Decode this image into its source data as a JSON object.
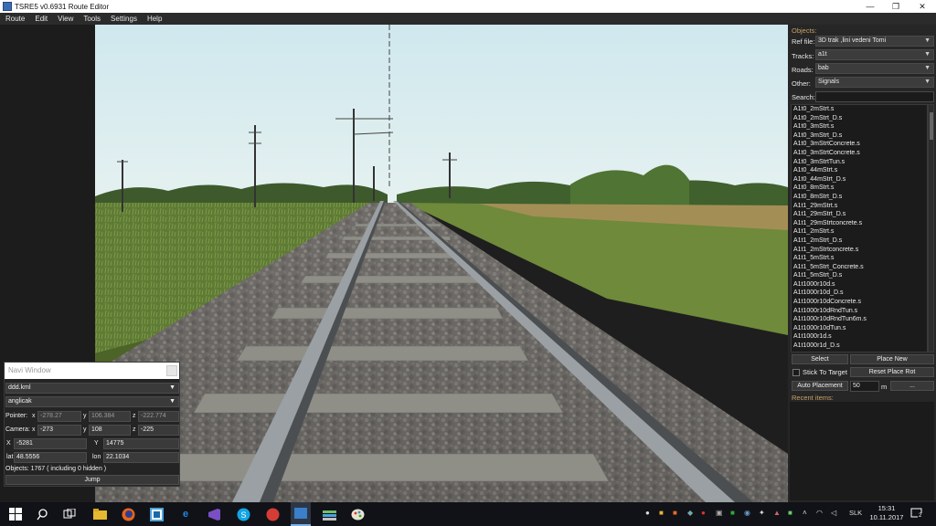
{
  "window": {
    "title": "TSRE5 v0.6931 Route Editor",
    "controls": [
      "—",
      "❐",
      "✕"
    ]
  },
  "menu": [
    "Route",
    "Edit",
    "View",
    "Tools",
    "Settings",
    "Help"
  ],
  "objects_panel": {
    "header": "Objects:",
    "ref_file_label": "Ref file:",
    "ref_file_value": "3D trak ,lini vedeni Tomi",
    "tracks_label": "Tracks:",
    "tracks_value": "a1t",
    "roads_label": "Roads:",
    "roads_value": "bab",
    "other_label": "Other:",
    "other_value": "Signals",
    "search_label": "Search:",
    "items": [
      "A1t0_2mStrt.s",
      "A1t0_2mStrt_D.s",
      "A1t0_3mStrt.s",
      "A1t0_3mStrt_D.s",
      "A1t0_3mStrtConcrete.s",
      "A1t0_3mStrtConcrete.s",
      "A1t0_3mStrtTun.s",
      "A1t0_44mStrt.s",
      "A1t0_44mStrt_D.s",
      "A1t0_8mStrt.s",
      "A1t0_8mStrt_D.s",
      "A1t1_29mStrt.s",
      "A1t1_29mStrt_D.s",
      "A1t1_29mStrtconcrete.s",
      "A1t1_2mStrt.s",
      "A1t1_2mStrt_D.s",
      "A1t1_2mStrtconcrete.s",
      "A1t1_5mStrt.s",
      "A1t1_5mStrt_Concrete.s",
      "A1t1_5mStrt_D.s",
      "A1t1000r10d.s",
      "A1t1000r10d_D.s",
      "A1t1000r10dConcrete.s",
      "A1t1000r10dRndTun.s",
      "A1t1000r10dRndTun6m.s",
      "A1t1000r10dTun.s",
      "A1t1000r1d.s",
      "A1t1000r1d_D.s"
    ],
    "select_label": "Select",
    "place_new_label": "Place New",
    "stick_to_target_label": "Stick To Target",
    "reset_place_rot_label": "Reset Place Rot",
    "auto_placement_label": "Auto Placement",
    "auto_placement_value": "50",
    "unit_label": "m",
    "more_label": "...",
    "recent_label": "Recent items:"
  },
  "navi": {
    "title": "Navi Window",
    "file_value": "ddd.kml",
    "profile_value": "anglicak",
    "pointer_label": "Pointer:",
    "pointer_x": "-278.27",
    "pointer_y": "106.384",
    "pointer_z": "-222.774",
    "camera_label": "Camera:",
    "camera_x": "-273",
    "camera_y": "108",
    "camera_z": "-225",
    "tile_x_label": "X",
    "tile_x": "-5281",
    "tile_y_label": "Y",
    "tile_y": "14775",
    "lat_label": "lat",
    "lat": "48.5556",
    "lon_label": "lon",
    "lon": "22.1034",
    "axis_x": "x",
    "axis_y": "y",
    "axis_z": "z",
    "objects_text": "Objects: 1767 ( including 0 hidden )",
    "jump_label": "Jump"
  },
  "taskbar": {
    "lang": "SLK",
    "time": "15:31",
    "date": "10.11.2017",
    "notification_count": "2"
  },
  "colors": {
    "sky": "#d9ecf0",
    "accent_window": "#3a6db5",
    "taskbar": "#111217"
  }
}
